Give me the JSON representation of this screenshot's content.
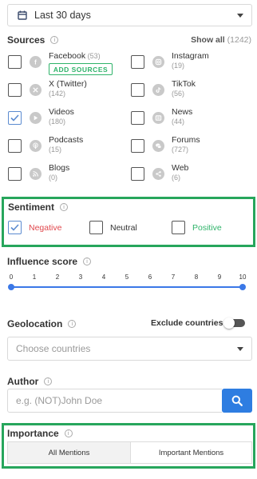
{
  "date_range": {
    "value": "Last 30 days"
  },
  "sources": {
    "title": "Sources",
    "show_all_label": "Show all",
    "show_all_count": "(1242)",
    "add_sources_label": "ADD SOURCES",
    "items": [
      {
        "name": "Facebook",
        "count": "(53)",
        "icon": "facebook-icon",
        "checked": false
      },
      {
        "name": "Instagram",
        "count": "(19)",
        "icon": "instagram-icon",
        "checked": false
      },
      {
        "name": "X (Twitter)",
        "count": "(142)",
        "icon": "x-twitter-icon",
        "checked": false
      },
      {
        "name": "TikTok",
        "count": "(56)",
        "icon": "tiktok-icon",
        "checked": false
      },
      {
        "name": "Videos",
        "count": "(180)",
        "icon": "play-icon",
        "checked": true
      },
      {
        "name": "News",
        "count": "(44)",
        "icon": "news-icon",
        "checked": false
      },
      {
        "name": "Podcasts",
        "count": "(15)",
        "icon": "podcast-icon",
        "checked": false
      },
      {
        "name": "Forums",
        "count": "(727)",
        "icon": "forum-icon",
        "checked": false
      },
      {
        "name": "Blogs",
        "count": "(0)",
        "icon": "rss-icon",
        "checked": false
      },
      {
        "name": "Web",
        "count": "(6)",
        "icon": "share-icon",
        "checked": false
      }
    ]
  },
  "sentiment": {
    "title": "Sentiment",
    "options": [
      {
        "label": "Negative",
        "checked": true,
        "color": "#e0474c"
      },
      {
        "label": "Neutral",
        "checked": false,
        "color": "#333333"
      },
      {
        "label": "Positive",
        "checked": false,
        "color": "#2fb36a"
      }
    ]
  },
  "influence": {
    "title": "Influence score",
    "ticks": [
      "0",
      "1",
      "2",
      "3",
      "4",
      "5",
      "6",
      "7",
      "8",
      "9",
      "10"
    ],
    "range": [
      0,
      10
    ]
  },
  "geolocation": {
    "title": "Geolocation",
    "exclude_label": "Exclude countries",
    "exclude_on": false,
    "placeholder": "Choose countries"
  },
  "author": {
    "title": "Author",
    "placeholder": "e.g. (NOT)John Doe"
  },
  "importance": {
    "title": "Importance",
    "options": [
      "All Mentions",
      "Important Mentions"
    ],
    "selected": "All Mentions"
  },
  "colors": {
    "accent": "#2e7de1",
    "highlight_border": "#27a65c"
  }
}
